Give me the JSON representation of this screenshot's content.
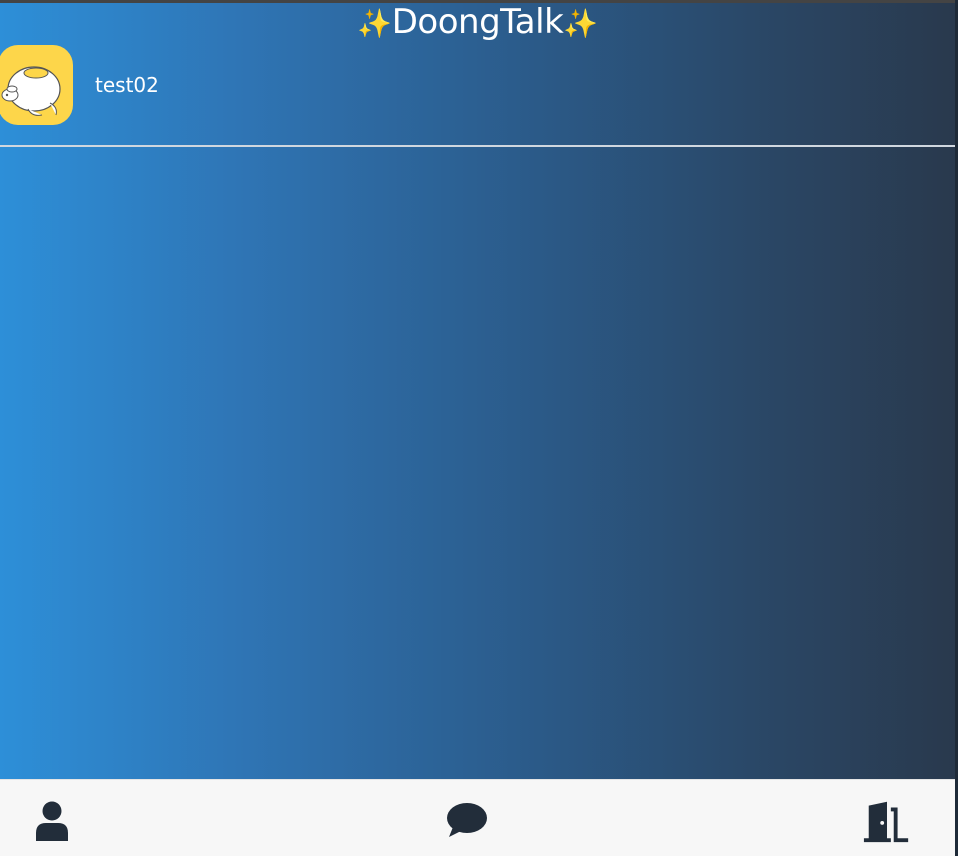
{
  "header": {
    "title": "DoongTalk",
    "sparkle_left": "✨",
    "sparkle_right": "✨"
  },
  "profile": {
    "username": "test02"
  },
  "nav": {
    "items": [
      {
        "name": "profile",
        "icon": "user-icon"
      },
      {
        "name": "chat",
        "icon": "chat-bubble-icon"
      },
      {
        "name": "exit",
        "icon": "door-exit-icon"
      }
    ]
  },
  "colors": {
    "gradient_start": "#2d8fd8",
    "gradient_end": "#29394d",
    "avatar_bg": "#fdd64a",
    "nav_bg": "#f7f7f7",
    "icon": "#222d3a"
  }
}
